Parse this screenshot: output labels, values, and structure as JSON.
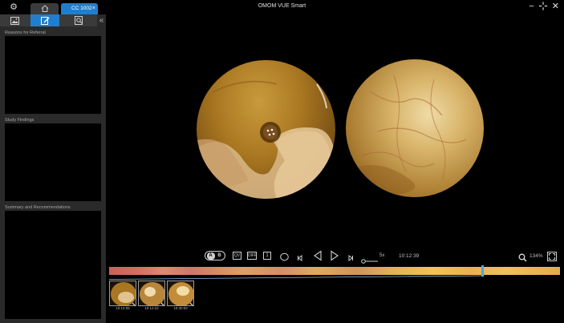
{
  "app": {
    "title": "OMOM VUE Smart",
    "tabs": [
      {
        "label": "",
        "icon": "home-icon"
      },
      {
        "label": "CC 1002",
        "icon": "close-icon",
        "active": true
      }
    ],
    "window_controls": [
      "minimize-icon",
      "restore-icon",
      "close-icon"
    ]
  },
  "left_panel": {
    "tabs": [
      {
        "icon": "image-icon"
      },
      {
        "icon": "edit-icon",
        "active": true
      },
      {
        "icon": "search-icon"
      }
    ],
    "sections": [
      {
        "label": "Reasons for Referral"
      },
      {
        "label": "Study Findings"
      },
      {
        "label": "Summary and Recommendations"
      }
    ]
  },
  "controls": {
    "ab": {
      "a": "A",
      "b": "B"
    },
    "view_buttons": [
      "QV",
      "DIFF",
      "1"
    ],
    "speed": "5x",
    "timestamp": "10:12:39",
    "zoom": "134%"
  },
  "timeline": {
    "position": 0.827
  },
  "thumbnails": [
    {
      "time": "10:12:05"
    },
    {
      "time": "10:12:22"
    },
    {
      "time": "10:30:02"
    }
  ],
  "colors": {
    "accent": "#1e7fd0",
    "panel": "#2a2a2a",
    "background": "#000000"
  }
}
